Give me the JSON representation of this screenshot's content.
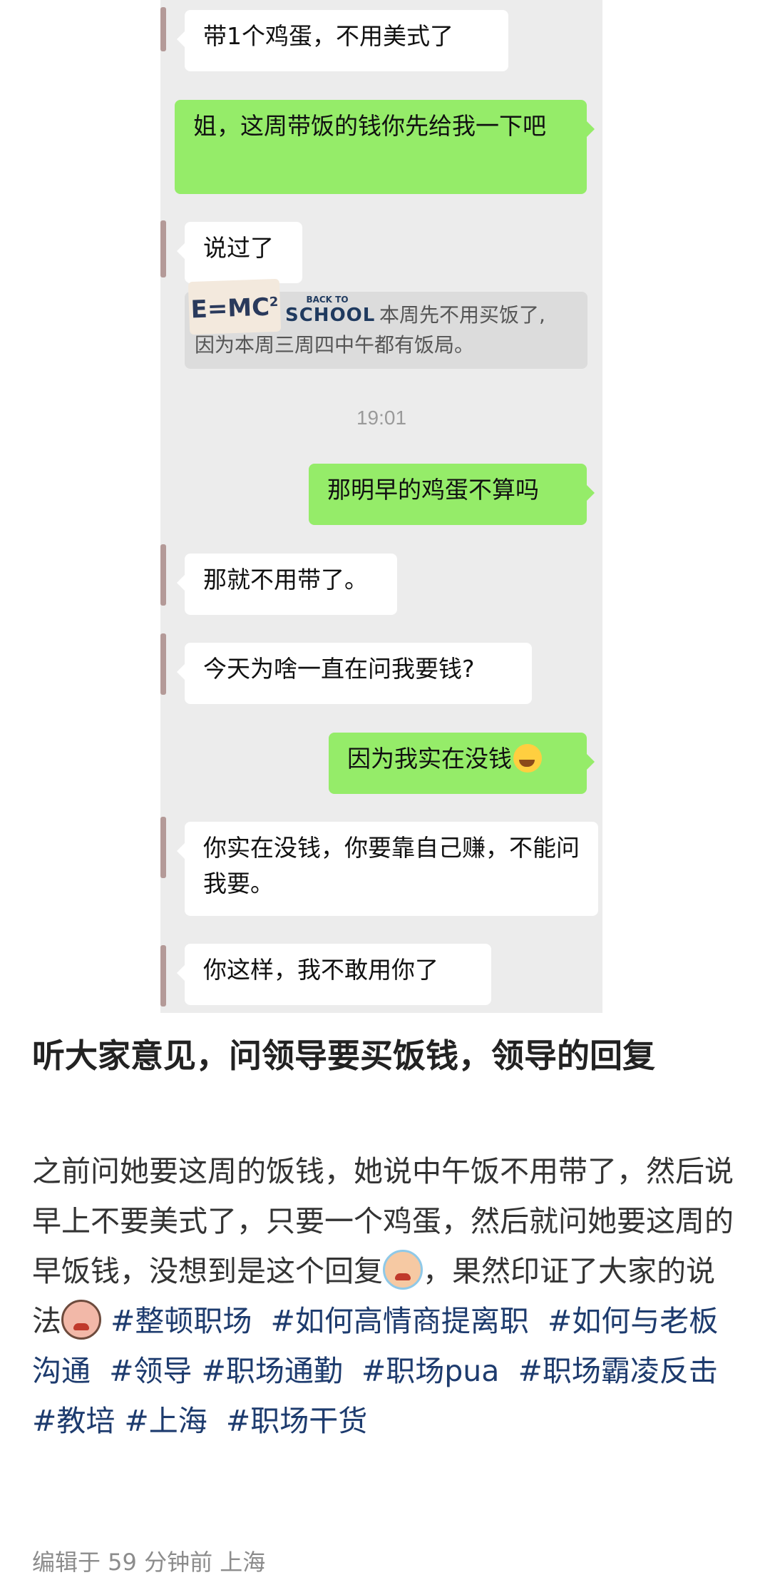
{
  "chat": {
    "messages": [
      {
        "side": "in",
        "text": "带1个鸡蛋，不用美式了"
      },
      {
        "side": "out",
        "text": "姐，这周带饭的钱你先给我一下吧"
      },
      {
        "side": "in",
        "text": "说过了"
      },
      {
        "side": "in",
        "text": "那就不用带了。"
      },
      {
        "side": "in",
        "text": "今天为啥一直在问我要钱?"
      },
      {
        "side": "out",
        "text": "因为我实在没钱"
      },
      {
        "side": "in",
        "text": "你实在没钱，你要靠自己赚，不能问我要。"
      },
      {
        "side": "in",
        "text": "你这样，我不敢用你了"
      },
      {
        "side": "out",
        "text": "那明早的鸡蛋不算吗"
      }
    ],
    "quote": {
      "line1": "本周先不用买饭了,",
      "line2": "因为本周三周四中午都有饭局。",
      "sticker_emc": "E=MC",
      "sticker_school_small": "BACK TO",
      "sticker_school_big": "SCHOOL"
    },
    "timestamp": "19:01"
  },
  "post": {
    "title": "听大家意见，问领导要买饭钱，领导的回复",
    "body_part1": "之前问她要这周的饭钱，她说中午饭不用带了，然后说早上不要美式了，只要一个鸡蛋，然后就问她要这周的早饭钱，没想到是这个回复",
    "body_part2": "，果然印证了大家的说法",
    "tags": [
      "#整顿职场",
      "#如何高情商提离职",
      "#如何与老板沟通",
      "#领导",
      "#职场通勤",
      "#职场pua",
      "#职场霸凌反击",
      "#教培",
      "#上海",
      "#职场干货"
    ],
    "meta": "编辑于 59 分钟前 上海"
  },
  "colors": {
    "chat_bg": "#ececec",
    "bubble_out": "#95ec69",
    "bubble_in": "#ffffff",
    "tag": "#1d3b6e"
  },
  "icons": [
    "laughing-crying-emoji",
    "crying-emoji",
    "angry-emoji"
  ]
}
